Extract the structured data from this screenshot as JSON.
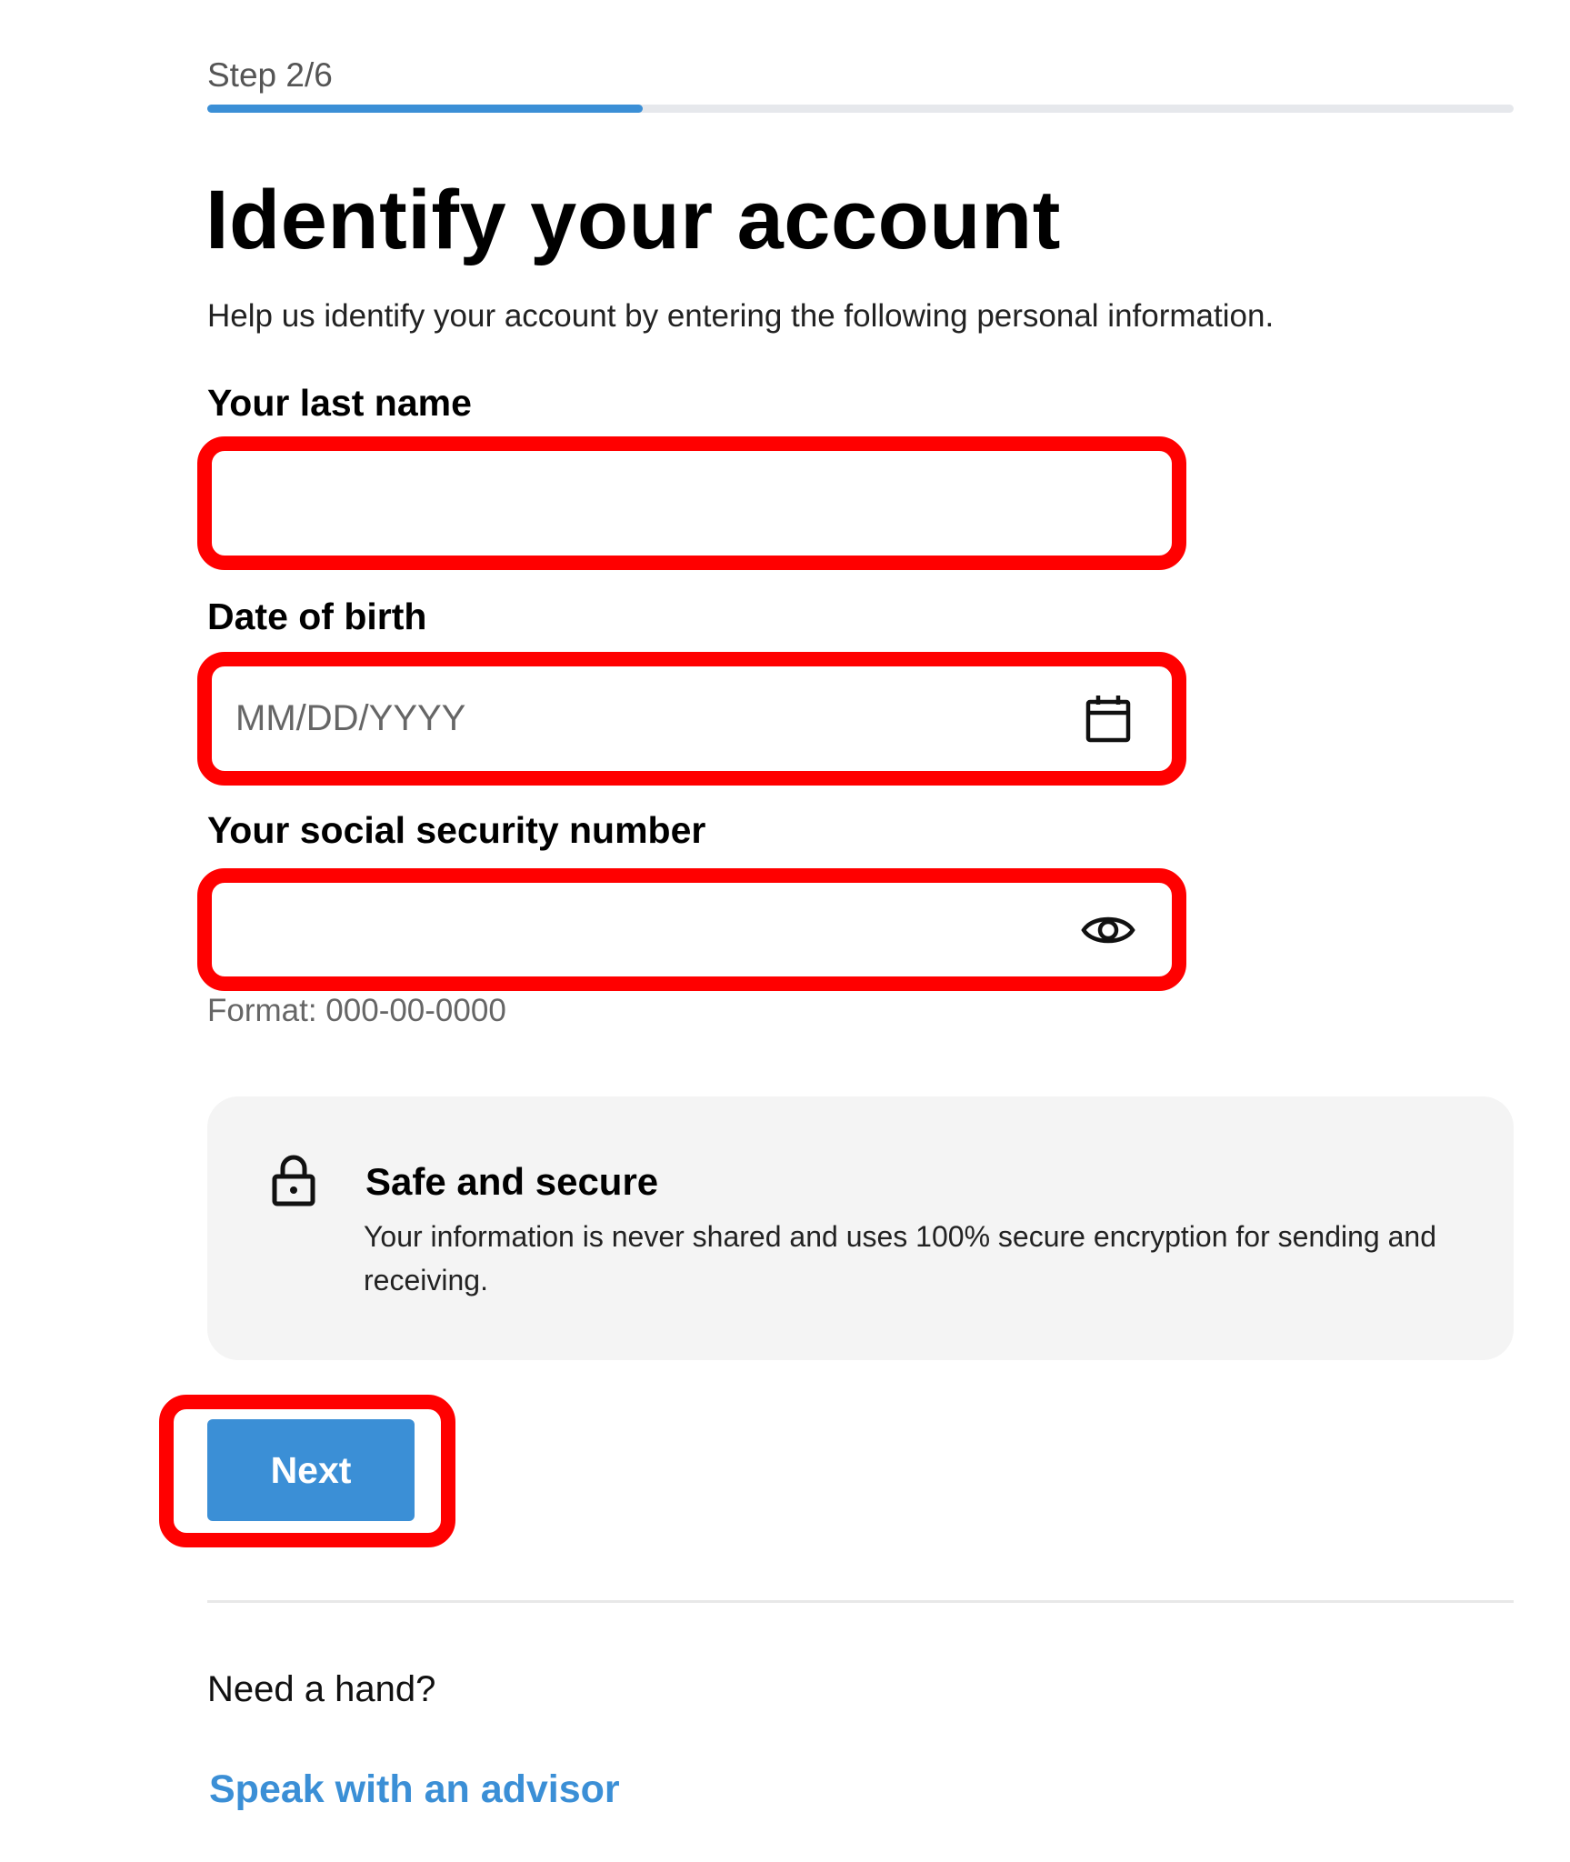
{
  "progress": {
    "step_label": "Step 2/6",
    "fraction": 0.333,
    "color": "#3b8fd6"
  },
  "header": {
    "title": "Identify your account",
    "subtitle": "Help us identify your account by entering the following personal information."
  },
  "form": {
    "last_name": {
      "label": "Your last name",
      "value": "",
      "placeholder": ""
    },
    "dob": {
      "label": "Date of birth",
      "value": "",
      "placeholder": "MM/DD/YYYY",
      "icon": "calendar-icon"
    },
    "ssn": {
      "label": "Your social security number",
      "value": "",
      "placeholder": "",
      "icon": "eye-icon",
      "hint": "Format: 000-00-0000"
    }
  },
  "security_notice": {
    "icon": "lock-icon",
    "title": "Safe and secure",
    "text": "Your information is never shared and uses 100% secure encryption for sending and receiving."
  },
  "actions": {
    "next_label": "Next"
  },
  "help": {
    "prompt": "Need a hand?",
    "link_label": "Speak with an advisor"
  },
  "colors": {
    "accent": "#3b8fd6",
    "highlight": "#ff0000",
    "panel_bg": "#f4f4f4"
  }
}
